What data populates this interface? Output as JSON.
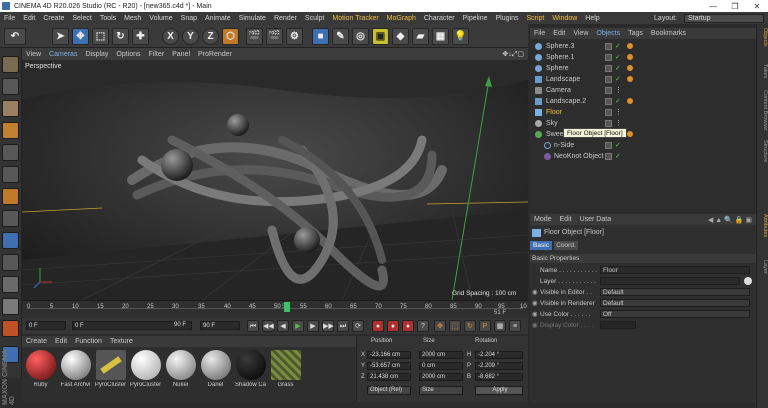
{
  "window": {
    "title": "CINEMA 4D R20.026 Studio (RC - R20) - [new365.c4d *] - Main",
    "controls": [
      "—",
      "❐",
      "✕"
    ]
  },
  "menu": {
    "items": [
      "File",
      "Edit",
      "Create",
      "Select",
      "Tools",
      "Mesh",
      "Volume",
      "Snap",
      "Animate",
      "Simulate",
      "Render",
      "Sculpt",
      "Motion Tracker",
      "MoGraph",
      "Character",
      "Pipeline",
      "Plugins",
      "Script",
      "Window",
      "Help"
    ],
    "highlighted": [
      "Motion Tracker",
      "MoGraph",
      "Script",
      "Window"
    ],
    "layout_label": "Layout:",
    "layout_value": "Startup"
  },
  "toolbar": {
    "axis_labels": [
      "X",
      "Y",
      "Z"
    ]
  },
  "viewport": {
    "menu": [
      "View",
      "Cameras",
      "Display",
      "Options",
      "Filter",
      "Panel",
      "ProRender"
    ],
    "label": "Perspective",
    "grid_spacing": "Grid Spacing : 100 cm"
  },
  "timeline": {
    "ticks": [
      "0",
      "5",
      "10",
      "15",
      "20",
      "25",
      "30",
      "35",
      "40",
      "45",
      "50",
      "55",
      "60",
      "65",
      "70",
      "75",
      "80",
      "85",
      "90",
      "95",
      "10"
    ],
    "current_frame": "51",
    "end_marker": "51 F"
  },
  "playback": {
    "start": "0 F",
    "start2": "0 F",
    "end": "90 F",
    "end2": "90 F"
  },
  "material_manager": {
    "menu": [
      "Create",
      "Edit",
      "Function",
      "Texture"
    ],
    "materials": [
      {
        "name": "Ruby",
        "color": "#7a1010"
      },
      {
        "name": "Fast Archvi",
        "color": "#9a9a9a"
      },
      {
        "name": "PyroCluster",
        "color": "#c8c860"
      },
      {
        "name": "PyroCluster",
        "color": "#e0e0e0"
      },
      {
        "name": "Nukei",
        "color": "#d0d0d0"
      },
      {
        "name": "Danel",
        "color": "#b8b8b8"
      },
      {
        "name": "Shadow Ca",
        "color": "#000000"
      },
      {
        "name": "Grass",
        "color": "#6a7a3a"
      }
    ]
  },
  "coords": {
    "headers": [
      "Position",
      "Size",
      "Rotation"
    ],
    "rows": [
      {
        "axis": "X",
        "pos": "-23.166 cm",
        "size": "2000 cm",
        "rot_axis": "H",
        "rot": "-2.204 °"
      },
      {
        "axis": "Y",
        "pos": "-53.657 cm",
        "size": "0 cm",
        "rot_axis": "P",
        "rot": "-2.209 °"
      },
      {
        "axis": "Z",
        "pos": "21.438 cm",
        "size": "2000 cm",
        "rot_axis": "B",
        "rot": "-8.682 °"
      }
    ],
    "mode": "Object (Rel)",
    "size_mode": "Size",
    "apply": "Apply"
  },
  "objects": {
    "menu": [
      "File",
      "Edit",
      "View",
      "Objects",
      "Tags",
      "Bookmarks"
    ],
    "items": [
      "Sphere.3",
      "Sphere.1",
      "Sphere",
      "Landscape",
      "Camera",
      "Landscape.2",
      "Floor",
      "Sky",
      "Sweep",
      "n-Side",
      "NeoKnot Object"
    ],
    "tooltip": "Floor Object [Floor]"
  },
  "attributes": {
    "menu": [
      "Mode",
      "Edit",
      "User Data"
    ],
    "object_title": "Floor Object [Floor]",
    "tabs": [
      "Basic",
      "Coord."
    ],
    "section": "Basic Properties",
    "props": [
      {
        "label": "Name . . . . . . . . . . .",
        "value": "Floor"
      },
      {
        "label": "Layer . . . . . . . . . . .",
        "value": ""
      },
      {
        "label": "Visible in Editor . .",
        "value": "Default"
      },
      {
        "label": "Visible in Renderer",
        "value": "Default"
      },
      {
        "label": "Use Color . . . . . .",
        "value": "Off"
      },
      {
        "label": "Display Color . . . .",
        "value": ""
      }
    ]
  },
  "right_tabs": [
    "Objects",
    "Takes",
    "Content Browser",
    "Structure",
    "Attributes",
    "Layer"
  ],
  "brand": "MAXON CINEMA 4D"
}
